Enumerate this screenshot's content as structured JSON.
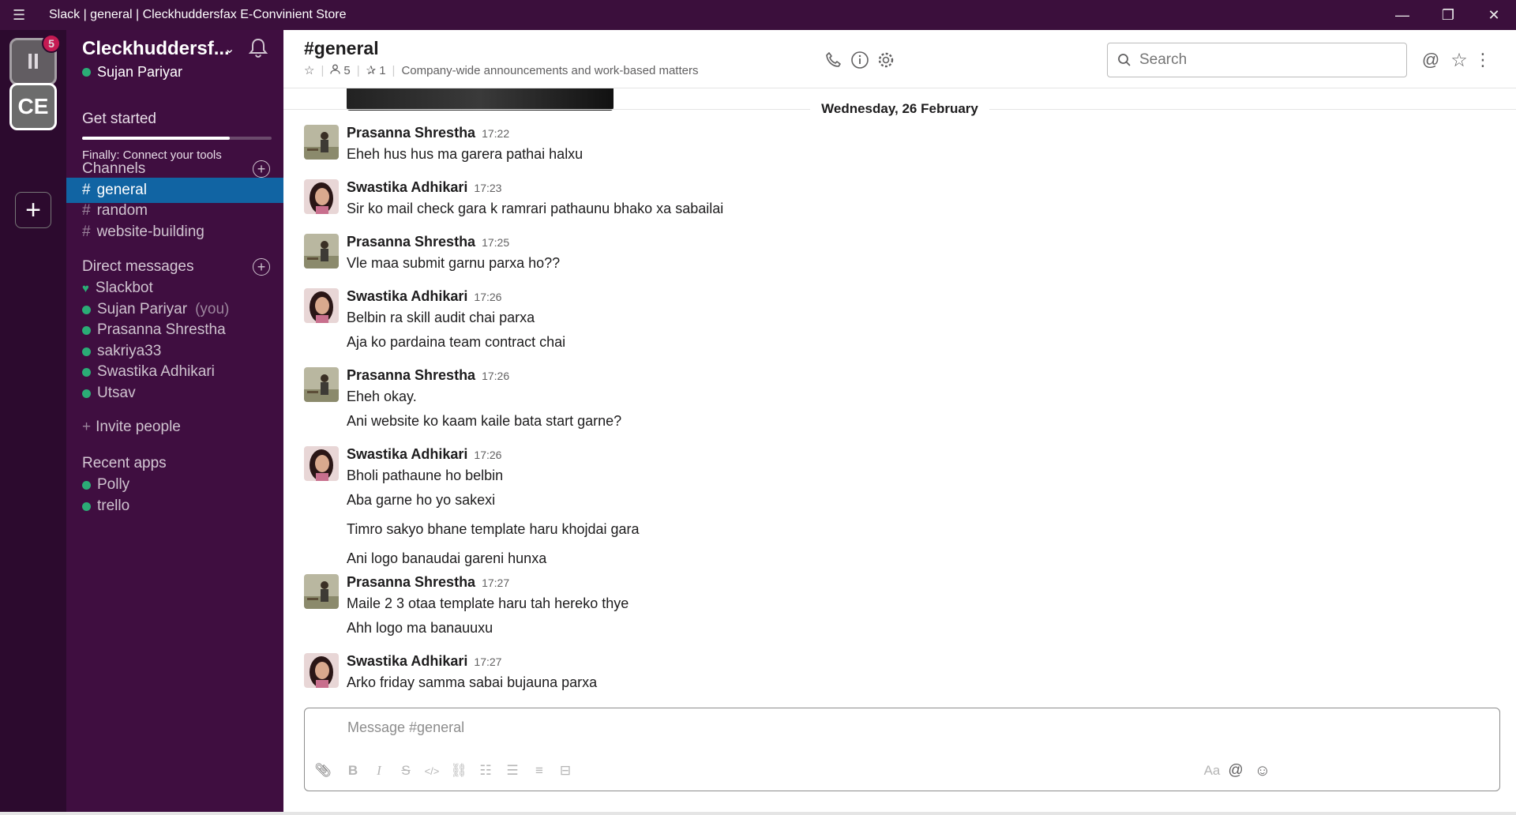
{
  "window": {
    "title": "Slack | general | Cleckhuddersfax E-Convinient Store"
  },
  "workspaces": [
    {
      "initials": "II",
      "badge": "5"
    },
    {
      "initials": "CE"
    }
  ],
  "sidebar": {
    "team_name": "Cleckhuddersf...",
    "user": "Sujan Pariyar",
    "get_started": "Get started",
    "get_started_progress": 0.78,
    "connect_tools": "Finally: Connect your tools",
    "channels_title": "Channels",
    "channels": [
      {
        "label": "general",
        "active": true
      },
      {
        "label": "random"
      },
      {
        "label": "website-building"
      }
    ],
    "dm_title": "Direct messages",
    "dms": [
      {
        "label": "Slackbot"
      },
      {
        "label": "Sujan Pariyar",
        "suffix": "(you)"
      },
      {
        "label": "Prasanna Shrestha"
      },
      {
        "label": "sakriya33"
      },
      {
        "label": "Swastika Adhikari"
      },
      {
        "label": "Utsav"
      }
    ],
    "invite": "Invite people",
    "apps_title": "Recent apps",
    "apps": [
      {
        "label": "Polly"
      },
      {
        "label": "trello"
      }
    ]
  },
  "header": {
    "channel": "#general",
    "members": "5",
    "pins": "1",
    "topic": "Company-wide announcements and work-based matters",
    "search_placeholder": "Search"
  },
  "date_divider": "Wednesday, 26 February",
  "messages": [
    {
      "author": "Prasanna Shrestha",
      "time": "17:22",
      "lines": [
        "Eheh hus hus ma garera pathai halxu"
      ]
    },
    {
      "author": "Swastika Adhikari",
      "time": "17:23",
      "lines": [
        "Sir ko mail check gara k ramrari pathaunu bhako xa sabailai"
      ]
    },
    {
      "author": "Prasanna Shrestha",
      "time": "17:25",
      "lines": [
        "Vle maa submit garnu parxa ho??"
      ]
    },
    {
      "author": "Swastika Adhikari",
      "time": "17:26",
      "lines": [
        "Belbin ra skill audit chai parxa",
        "Aja ko pardaina team contract chai"
      ]
    },
    {
      "author": "Prasanna Shrestha",
      "time": "17:26",
      "lines": [
        "Eheh okay.",
        "Ani website ko kaam kaile bata start garne?"
      ]
    },
    {
      "author": "Swastika Adhikari",
      "time": "17:26",
      "lines": [
        "Bholi pathaune ho belbin",
        "Aba garne ho yo sakexi",
        "Timro sakyo bhane template haru khojdai gara",
        "Ani logo banaudai gareni hunxa"
      ]
    },
    {
      "author": "Prasanna Shrestha",
      "time": "17:27",
      "lines": [
        "Maile 2 3 otaa template haru tah hereko thye",
        "Ahh logo ma banauuxu"
      ]
    },
    {
      "author": "Swastika Adhikari",
      "time": "17:27",
      "lines": [
        "Arko friday samma sabai bujauna parxa"
      ]
    }
  ],
  "composer": {
    "placeholder": "Message #general",
    "aa_label": "Aa"
  },
  "colors": {
    "sidebar": "#3f0e40",
    "active": "#1164a3",
    "presence": "#2bac76",
    "badge": "#e01e5a"
  }
}
